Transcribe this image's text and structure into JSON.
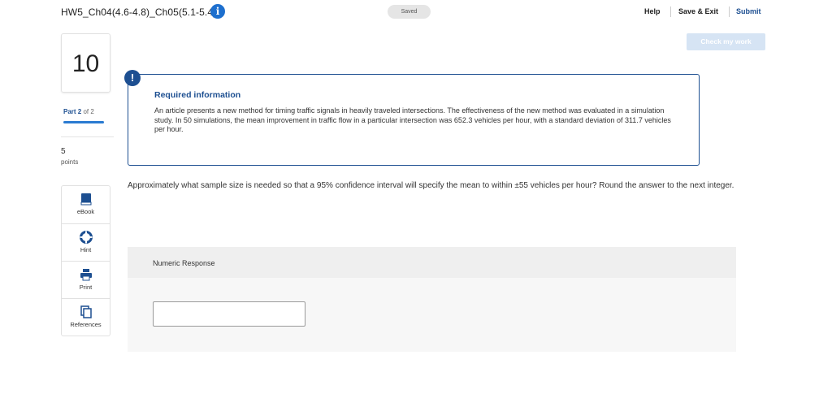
{
  "header": {
    "assignment_title": "HW5_Ch04(4.6-4.8)_Ch05(5.1-5.4)",
    "info_icon": "i",
    "saved_status": "Saved",
    "help_label": "Help",
    "save_exit_label": "Save & Exit",
    "submit_label": "Submit"
  },
  "check_work_label": "Check my work",
  "question_number": "10",
  "part": {
    "prefix": "Part",
    "current": "2",
    "of_text": "of 2",
    "progress": 1.0
  },
  "points": {
    "value": "5",
    "label": "points"
  },
  "tools": [
    {
      "icon": "book-icon",
      "label": "eBook"
    },
    {
      "icon": "lifebuoy-icon",
      "label": "Hint"
    },
    {
      "icon": "printer-icon",
      "label": "Print"
    },
    {
      "icon": "copy-icon",
      "label": "References"
    }
  ],
  "required_info": {
    "alert_icon": "!",
    "title": "Required information",
    "text": "An article presents a new method for timing traffic signals in heavily traveled intersections. The effectiveness of the new method was evaluated in a simulation study. In 50 simulations, the mean improvement in traffic flow in a particular intersection was 652.3 vehicles per hour, with a standard deviation of 311.7 vehicles per hour."
  },
  "question_text": "Approximately what sample size is needed so that a 95% confidence interval will specify the mean to within ±55 vehicles per hour? Round the answer to the next integer.",
  "response": {
    "label": "Numeric Response",
    "value": ""
  },
  "colors": {
    "accent": "#1d4f91",
    "link_blue": "#2a7bd1",
    "info_blue": "#1d6fce"
  }
}
